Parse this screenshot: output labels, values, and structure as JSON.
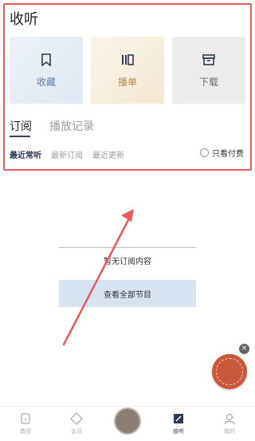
{
  "header": {
    "title": "收听"
  },
  "cards": [
    {
      "label": "收藏",
      "icon": "bookmark-icon"
    },
    {
      "label": "播单",
      "icon": "playlist-icon"
    },
    {
      "label": "下载",
      "icon": "download-box-icon"
    }
  ],
  "tabs": [
    {
      "label": "订阅",
      "active": true
    },
    {
      "label": "播放记录",
      "active": false
    }
  ],
  "filters": [
    "最近常听",
    "最新订阅",
    "最近更新"
  ],
  "paid_only": {
    "label": "只看付费",
    "checked": false
  },
  "empty": {
    "message": "暂无订阅内容",
    "button_label": "查看全部节目"
  },
  "tabbar": [
    {
      "label": "首页",
      "icon": "home-icon",
      "active": false
    },
    {
      "label": "会员",
      "icon": "diamond-icon",
      "active": false
    },
    {
      "label": "",
      "icon": "center-avatar",
      "active": false
    },
    {
      "label": "收听",
      "icon": "listen-icon",
      "active": true
    },
    {
      "label": "我的",
      "icon": "user-icon",
      "active": false
    }
  ],
  "colors": {
    "annotation_red": "#ea5a5a",
    "accent_navy": "#2b3a57",
    "button_blue": "#d8e3f1",
    "float_badge": "#c7583a"
  }
}
